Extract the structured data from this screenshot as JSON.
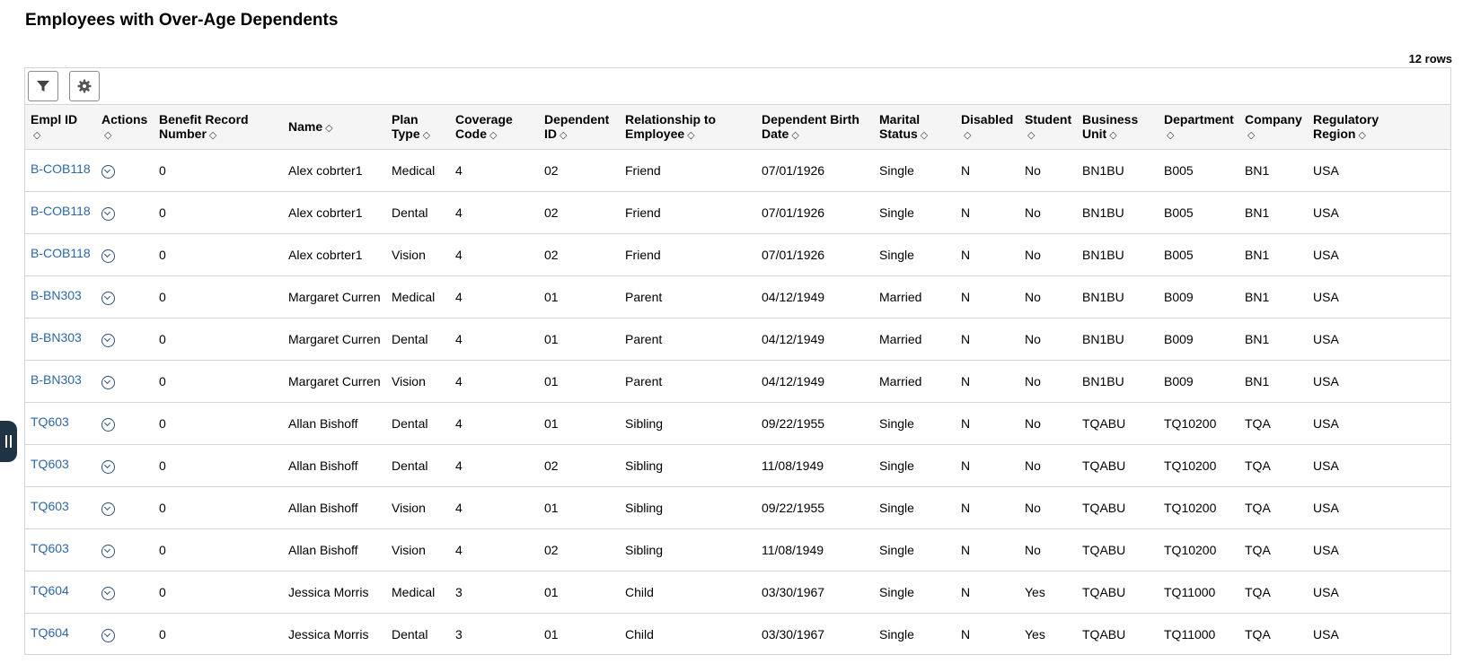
{
  "page_title": "Employees with Over-Age Dependents",
  "row_count": "12 rows",
  "icons": {
    "filter": "filter-icon",
    "settings": "gear-icon",
    "actions": "chevron-down-circle-icon",
    "sort": "sort-icon",
    "side_handle": "drag-handle-icon"
  },
  "colors": {
    "link": "#2a67b0",
    "header_bg": "#f5f5f5",
    "border": "#d5d5d5",
    "side_handle": "#1e3344"
  },
  "columns": [
    {
      "l1": "Empl ID",
      "l2": ""
    },
    {
      "l1": "Actions",
      "l2": ""
    },
    {
      "l1": "Benefit Record",
      "l2": "Number"
    },
    {
      "l1": "Name",
      "l2": ""
    },
    {
      "l1": "Plan",
      "l2": "Type"
    },
    {
      "l1": "Coverage",
      "l2": "Code"
    },
    {
      "l1": "Dependent",
      "l2": "ID"
    },
    {
      "l1": "Relationship to",
      "l2": "Employee"
    },
    {
      "l1": "Dependent Birth",
      "l2": "Date"
    },
    {
      "l1": "Marital",
      "l2": "Status"
    },
    {
      "l1": "Disabled",
      "l2": ""
    },
    {
      "l1": "Student",
      "l2": ""
    },
    {
      "l1": "Business",
      "l2": "Unit"
    },
    {
      "l1": "Department",
      "l2": ""
    },
    {
      "l1": "Company",
      "l2": ""
    },
    {
      "l1": "Regulatory",
      "l2": "Region"
    }
  ],
  "rows": [
    {
      "empl_id": "B-COB118",
      "benefit_record": "0",
      "name": "Alex cobrter1",
      "plan_type": "Medical",
      "coverage_code": "4",
      "dependent_id": "02",
      "relationship": "Friend",
      "birth_date": "07/01/1926",
      "marital_status": "Single",
      "disabled": "N",
      "student": "No",
      "business_unit": "BN1BU",
      "department": "B005",
      "company": "BN1",
      "region": "USA"
    },
    {
      "empl_id": "B-COB118",
      "benefit_record": "0",
      "name": "Alex cobrter1",
      "plan_type": "Dental",
      "coverage_code": "4",
      "dependent_id": "02",
      "relationship": "Friend",
      "birth_date": "07/01/1926",
      "marital_status": "Single",
      "disabled": "N",
      "student": "No",
      "business_unit": "BN1BU",
      "department": "B005",
      "company": "BN1",
      "region": "USA"
    },
    {
      "empl_id": "B-COB118",
      "benefit_record": "0",
      "name": "Alex cobrter1",
      "plan_type": "Vision",
      "coverage_code": "4",
      "dependent_id": "02",
      "relationship": "Friend",
      "birth_date": "07/01/1926",
      "marital_status": "Single",
      "disabled": "N",
      "student": "No",
      "business_unit": "BN1BU",
      "department": "B005",
      "company": "BN1",
      "region": "USA"
    },
    {
      "empl_id": "B-BN303",
      "benefit_record": "0",
      "name": "Margaret Curren",
      "plan_type": "Medical",
      "coverage_code": "4",
      "dependent_id": "01",
      "relationship": "Parent",
      "birth_date": "04/12/1949",
      "marital_status": "Married",
      "disabled": "N",
      "student": "No",
      "business_unit": "BN1BU",
      "department": "B009",
      "company": "BN1",
      "region": "USA"
    },
    {
      "empl_id": "B-BN303",
      "benefit_record": "0",
      "name": "Margaret Curren",
      "plan_type": "Dental",
      "coverage_code": "4",
      "dependent_id": "01",
      "relationship": "Parent",
      "birth_date": "04/12/1949",
      "marital_status": "Married",
      "disabled": "N",
      "student": "No",
      "business_unit": "BN1BU",
      "department": "B009",
      "company": "BN1",
      "region": "USA"
    },
    {
      "empl_id": "B-BN303",
      "benefit_record": "0",
      "name": "Margaret Curren",
      "plan_type": "Vision",
      "coverage_code": "4",
      "dependent_id": "01",
      "relationship": "Parent",
      "birth_date": "04/12/1949",
      "marital_status": "Married",
      "disabled": "N",
      "student": "No",
      "business_unit": "BN1BU",
      "department": "B009",
      "company": "BN1",
      "region": "USA"
    },
    {
      "empl_id": "TQ603",
      "benefit_record": "0",
      "name": "Allan Bishoff",
      "plan_type": "Dental",
      "coverage_code": "4",
      "dependent_id": "01",
      "relationship": "Sibling",
      "birth_date": "09/22/1955",
      "marital_status": "Single",
      "disabled": "N",
      "student": "No",
      "business_unit": "TQABU",
      "department": "TQ10200",
      "company": "TQA",
      "region": "USA"
    },
    {
      "empl_id": "TQ603",
      "benefit_record": "0",
      "name": "Allan Bishoff",
      "plan_type": "Dental",
      "coverage_code": "4",
      "dependent_id": "02",
      "relationship": "Sibling",
      "birth_date": "11/08/1949",
      "marital_status": "Single",
      "disabled": "N",
      "student": "No",
      "business_unit": "TQABU",
      "department": "TQ10200",
      "company": "TQA",
      "region": "USA"
    },
    {
      "empl_id": "TQ603",
      "benefit_record": "0",
      "name": "Allan Bishoff",
      "plan_type": "Vision",
      "coverage_code": "4",
      "dependent_id": "01",
      "relationship": "Sibling",
      "birth_date": "09/22/1955",
      "marital_status": "Single",
      "disabled": "N",
      "student": "No",
      "business_unit": "TQABU",
      "department": "TQ10200",
      "company": "TQA",
      "region": "USA"
    },
    {
      "empl_id": "TQ603",
      "benefit_record": "0",
      "name": "Allan Bishoff",
      "plan_type": "Vision",
      "coverage_code": "4",
      "dependent_id": "02",
      "relationship": "Sibling",
      "birth_date": "11/08/1949",
      "marital_status": "Single",
      "disabled": "N",
      "student": "No",
      "business_unit": "TQABU",
      "department": "TQ10200",
      "company": "TQA",
      "region": "USA"
    },
    {
      "empl_id": "TQ604",
      "benefit_record": "0",
      "name": "Jessica Morris",
      "plan_type": "Medical",
      "coverage_code": "3",
      "dependent_id": "01",
      "relationship": "Child",
      "birth_date": "03/30/1967",
      "marital_status": "Single",
      "disabled": "N",
      "student": "Yes",
      "business_unit": "TQABU",
      "department": "TQ11000",
      "company": "TQA",
      "region": "USA"
    },
    {
      "empl_id": "TQ604",
      "benefit_record": "0",
      "name": "Jessica Morris",
      "plan_type": "Dental",
      "coverage_code": "3",
      "dependent_id": "01",
      "relationship": "Child",
      "birth_date": "03/30/1967",
      "marital_status": "Single",
      "disabled": "N",
      "student": "Yes",
      "business_unit": "TQABU",
      "department": "TQ11000",
      "company": "TQA",
      "region": "USA"
    }
  ]
}
